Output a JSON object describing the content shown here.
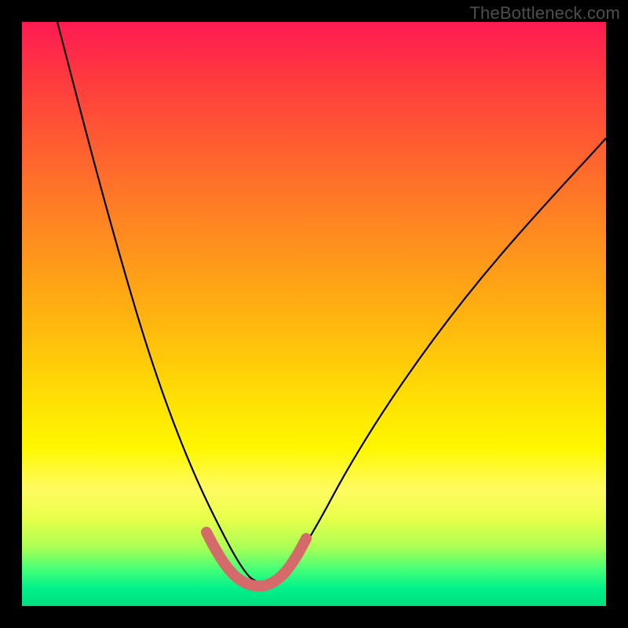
{
  "watermark": "TheBottleneck.com",
  "chart_data": {
    "type": "line",
    "title": "",
    "xlabel": "",
    "ylabel": "",
    "xlim": [
      0,
      100
    ],
    "ylim": [
      0,
      100
    ],
    "grid": false,
    "series": [
      {
        "name": "bottleneck-curve",
        "x": [
          6,
          10,
          14,
          18,
          22,
          26,
          30,
          32,
          34,
          36,
          38,
          40,
          42,
          44,
          48,
          54,
          62,
          72,
          84,
          100
        ],
        "y": [
          100,
          84,
          68,
          54,
          41,
          29,
          18,
          13,
          9,
          6,
          4,
          4,
          4,
          6,
          10,
          18,
          30,
          44,
          58,
          72
        ]
      }
    ],
    "highlight": {
      "name": "trough-highlight",
      "x": [
        30,
        32,
        34,
        36,
        38,
        40,
        42,
        44,
        46
      ],
      "y": [
        12,
        8,
        6,
        5,
        4,
        4,
        5,
        7,
        10
      ],
      "color": "#d46a6a"
    },
    "background_gradient": {
      "top": "#ff1a53",
      "mid": "#fff700",
      "bottom": "#00df7d"
    }
  }
}
